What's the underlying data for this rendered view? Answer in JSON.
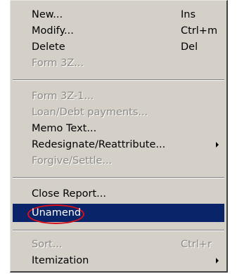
{
  "menu": {
    "items": [
      {
        "label": "New...",
        "shortcut": "Ins",
        "disabled": false
      },
      {
        "label": "Modify...",
        "shortcut": "Ctrl+m",
        "disabled": false
      },
      {
        "label": "Delete",
        "shortcut": "Del",
        "disabled": false
      },
      {
        "label": "Form 3Z...",
        "shortcut": "",
        "disabled": true
      },
      {
        "label": "Form 3Z-1...",
        "shortcut": "",
        "disabled": true
      },
      {
        "label": "Loan/Debt payments...",
        "shortcut": "",
        "disabled": true
      },
      {
        "label": "Memo Text...",
        "shortcut": "",
        "disabled": false
      },
      {
        "label": "Redesignate/Reattribute...",
        "shortcut": "",
        "disabled": false,
        "submenu": true
      },
      {
        "label": "Forgive/Settle...",
        "shortcut": "",
        "disabled": true
      },
      {
        "label": "Close Report...",
        "shortcut": "",
        "disabled": false
      },
      {
        "label": "Unamend",
        "shortcut": "",
        "disabled": false,
        "selected": true,
        "highlighted": true
      },
      {
        "label": "Sort...",
        "shortcut": "Ctrl+r",
        "disabled": true
      },
      {
        "label": "Itemization",
        "shortcut": "",
        "disabled": false,
        "submenu": true
      }
    ]
  },
  "colors": {
    "menu_background": "#d4d0c8",
    "selection": "#0a246a",
    "annotation": "#d8101a",
    "disabled_text": "#8c8a86"
  }
}
